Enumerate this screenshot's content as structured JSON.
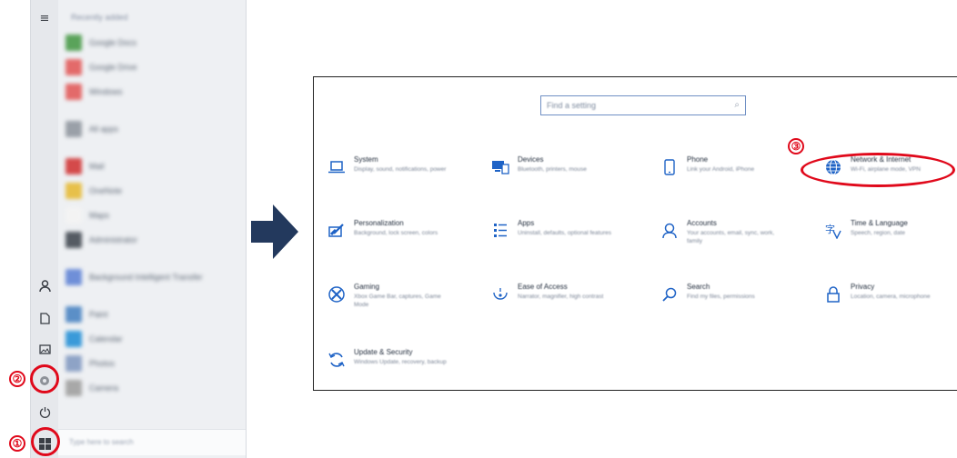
{
  "start_menu": {
    "header": "Recently added",
    "apps": [
      {
        "label": "Google Docs",
        "color": "#5aa35a"
      },
      {
        "label": "Google Drive",
        "color": "#e36a6a"
      },
      {
        "label": "Windows",
        "color": "#e36a6a"
      },
      {
        "label": "",
        "color": ""
      },
      {
        "label": "All apps",
        "color": "#9aa0a8"
      },
      {
        "label": "",
        "color": ""
      },
      {
        "label": "Mail",
        "color": "#d44a4a"
      },
      {
        "label": "OneNote",
        "color": "#e7c04a"
      },
      {
        "label": "Maps",
        "color": "#f3f3f3"
      },
      {
        "label": "Administrator",
        "color": "#555b63"
      },
      {
        "label": "",
        "color": ""
      },
      {
        "label": "Background Intelligent Transfer",
        "color": "#6f8fd8"
      },
      {
        "label": "",
        "color": ""
      },
      {
        "label": "Paint",
        "color": "#5b8fc7"
      },
      {
        "label": "Calendar",
        "color": "#3a9ad9"
      },
      {
        "label": "Photos",
        "color": "#8ea3c6"
      },
      {
        "label": "Camera",
        "color": "#a8a8a8"
      }
    ],
    "search_placeholder": "Type here to search",
    "rail_icons": [
      "hamburger-icon",
      "user-icon",
      "document-icon",
      "pictures-icon",
      "settings-icon",
      "power-icon",
      "windows-icon"
    ]
  },
  "markers": {
    "one": "①",
    "two": "②",
    "three": "③",
    "color": "#e0091b"
  },
  "settings": {
    "search_placeholder": "Find a setting",
    "tiles": [
      {
        "icon": "laptop-icon",
        "title": "System",
        "desc": "Display, sound, notifications, power"
      },
      {
        "icon": "devices-icon",
        "title": "Devices",
        "desc": "Bluetooth, printers, mouse"
      },
      {
        "icon": "phone-icon",
        "title": "Phone",
        "desc": "Link your Android, iPhone"
      },
      {
        "icon": "globe-icon",
        "title": "Network & Internet",
        "desc": "Wi-Fi, airplane mode, VPN"
      },
      {
        "icon": "personalization-icon",
        "title": "Personalization",
        "desc": "Background, lock screen, colors"
      },
      {
        "icon": "apps-icon",
        "title": "Apps",
        "desc": "Uninstall, defaults, optional features"
      },
      {
        "icon": "accounts-icon",
        "title": "Accounts",
        "desc": "Your accounts, email, sync, work, family"
      },
      {
        "icon": "time-language-icon",
        "title": "Time & Language",
        "desc": "Speech, region, date"
      },
      {
        "icon": "gaming-icon",
        "title": "Gaming",
        "desc": "Xbox Game Bar, captures, Game Mode"
      },
      {
        "icon": "ease-of-access-icon",
        "title": "Ease of Access",
        "desc": "Narrator, magnifier, high contrast"
      },
      {
        "icon": "search-icon",
        "title": "Search",
        "desc": "Find my files, permissions"
      },
      {
        "icon": "lock-icon",
        "title": "Privacy",
        "desc": "Location, camera, microphone"
      },
      {
        "icon": "update-icon",
        "title": "Update & Security",
        "desc": "Windows Update, recovery, backup"
      }
    ],
    "accent": "#1f63c6"
  },
  "arrow_color": "#23395d"
}
